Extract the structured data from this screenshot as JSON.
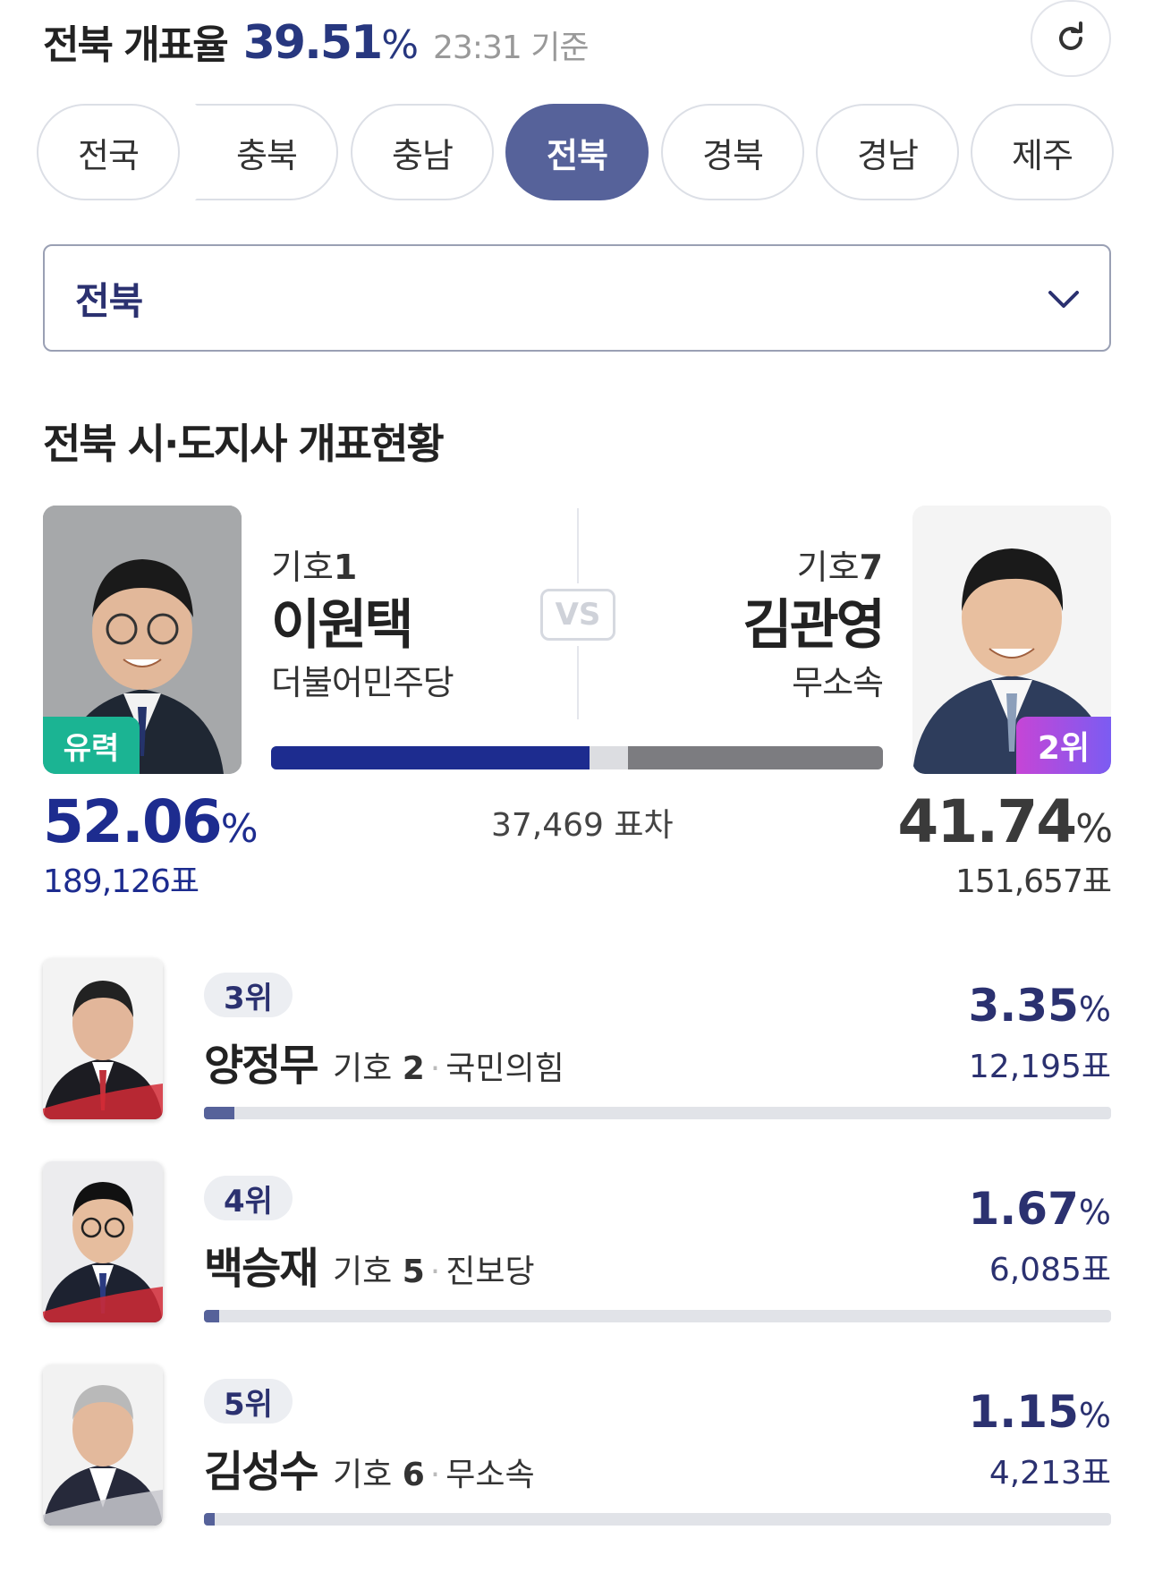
{
  "header": {
    "title": "전북 개표율",
    "rate": "39.51",
    "rate_unit": "%",
    "time": "23:31 기준"
  },
  "tabs": [
    {
      "label": "전국",
      "active": false
    },
    {
      "label": "충북",
      "active": false
    },
    {
      "label": "충남",
      "active": false
    },
    {
      "label": "전북",
      "active": true
    },
    {
      "label": "경북",
      "active": false
    },
    {
      "label": "경남",
      "active": false
    },
    {
      "label": "제주",
      "active": false
    }
  ],
  "region_select": {
    "value": "전북"
  },
  "section_title": "전북 시·도지사 개표현황",
  "top_two": {
    "left": {
      "number_label": "기호",
      "number": "1",
      "name": "이원택",
      "party": "더불어민주당",
      "badge": "유력",
      "pct": "52.06",
      "pct_unit": "%",
      "votes": "189,126표",
      "pct_value": 52.06
    },
    "vs": "VS",
    "diff": "37,469 표차",
    "right": {
      "number_label": "기호",
      "number": "7",
      "name": "김관영",
      "party": "무소속",
      "badge": "2위",
      "pct": "41.74",
      "pct_unit": "%",
      "votes": "151,657표",
      "pct_value": 41.74
    }
  },
  "others": [
    {
      "rank": "3위",
      "name": "양정무",
      "number_label": "기호",
      "number": "2",
      "party": "국민의힘",
      "pct": "3.35",
      "pct_unit": "%",
      "votes": "12,195표",
      "pct_value": 3.35
    },
    {
      "rank": "4위",
      "name": "백승재",
      "number_label": "기호",
      "number": "5",
      "party": "진보당",
      "pct": "1.67",
      "pct_unit": "%",
      "votes": "6,085표",
      "pct_value": 1.67
    },
    {
      "rank": "5위",
      "name": "김성수",
      "number_label": "기호",
      "number": "6",
      "party": "무소속",
      "pct": "1.15",
      "pct_unit": "%",
      "votes": "4,213표",
      "pct_value": 1.15
    }
  ],
  "colors": {
    "accent": "#27377f",
    "leader_bar": "#1d2c8f",
    "runnerup_bar": "#7c7c80",
    "lead_badge": "#1bb493",
    "active_tab": "#56629a"
  },
  "icons": {
    "refresh": "refresh-icon",
    "dropdown": "chevron-down-icon"
  }
}
